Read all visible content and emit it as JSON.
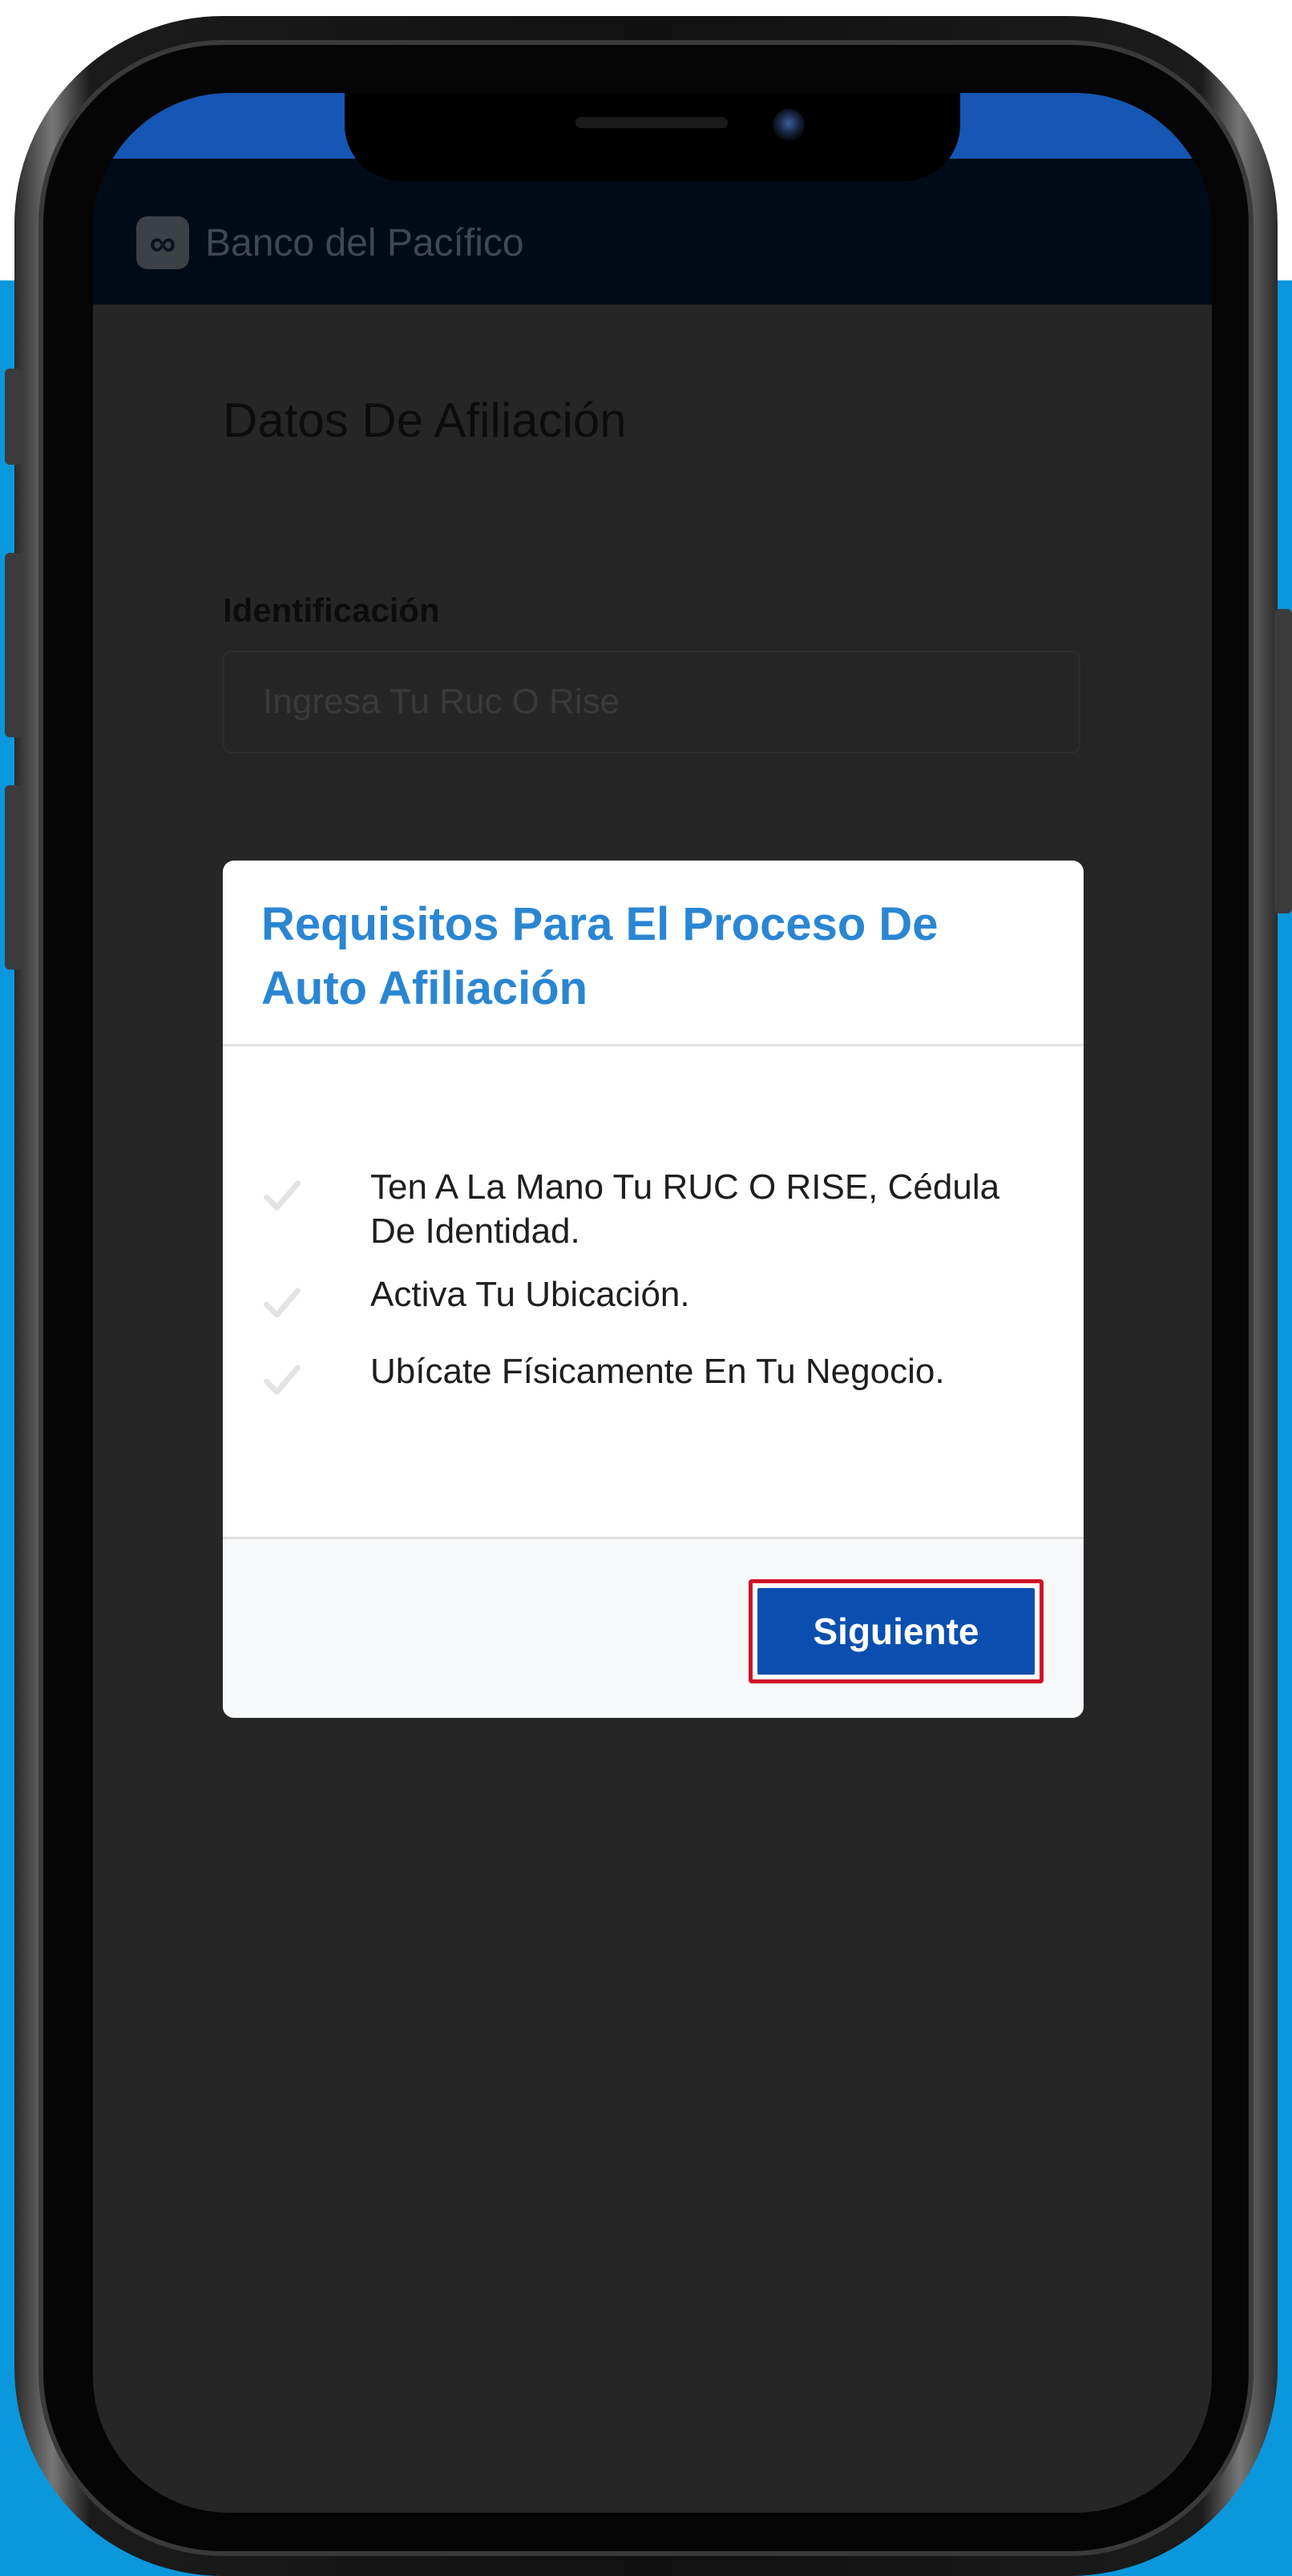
{
  "app": {
    "brand_name": "Banco del Pacífico",
    "logo_glyph": "∞"
  },
  "page": {
    "title": "Datos De Afiliación",
    "identification_label": "Identificación",
    "identification_placeholder": "Ingresa Tu Ruc O Rise",
    "identification_value": ""
  },
  "modal": {
    "title": "Requisitos Para El Proceso De Auto Afiliación",
    "requirements": [
      {
        "text": "Ten A La Mano Tu RUC O RISE, Cédula De Identidad.",
        "icon": "check-icon"
      },
      {
        "text": "Activa Tu Ubicación.",
        "icon": "check-icon"
      },
      {
        "text": "Ubícate Físicamente En Tu Negocio.",
        "icon": "check-icon"
      }
    ],
    "next_button_label": "Siguiente"
  },
  "colors": {
    "backdrop": "#0a97dc",
    "status_bar": "#1656b4",
    "modal_title": "#2a86d3",
    "primary_button": "#0a4fb0",
    "highlight_outline": "#d0102a",
    "overlay_screen": "#262626"
  }
}
